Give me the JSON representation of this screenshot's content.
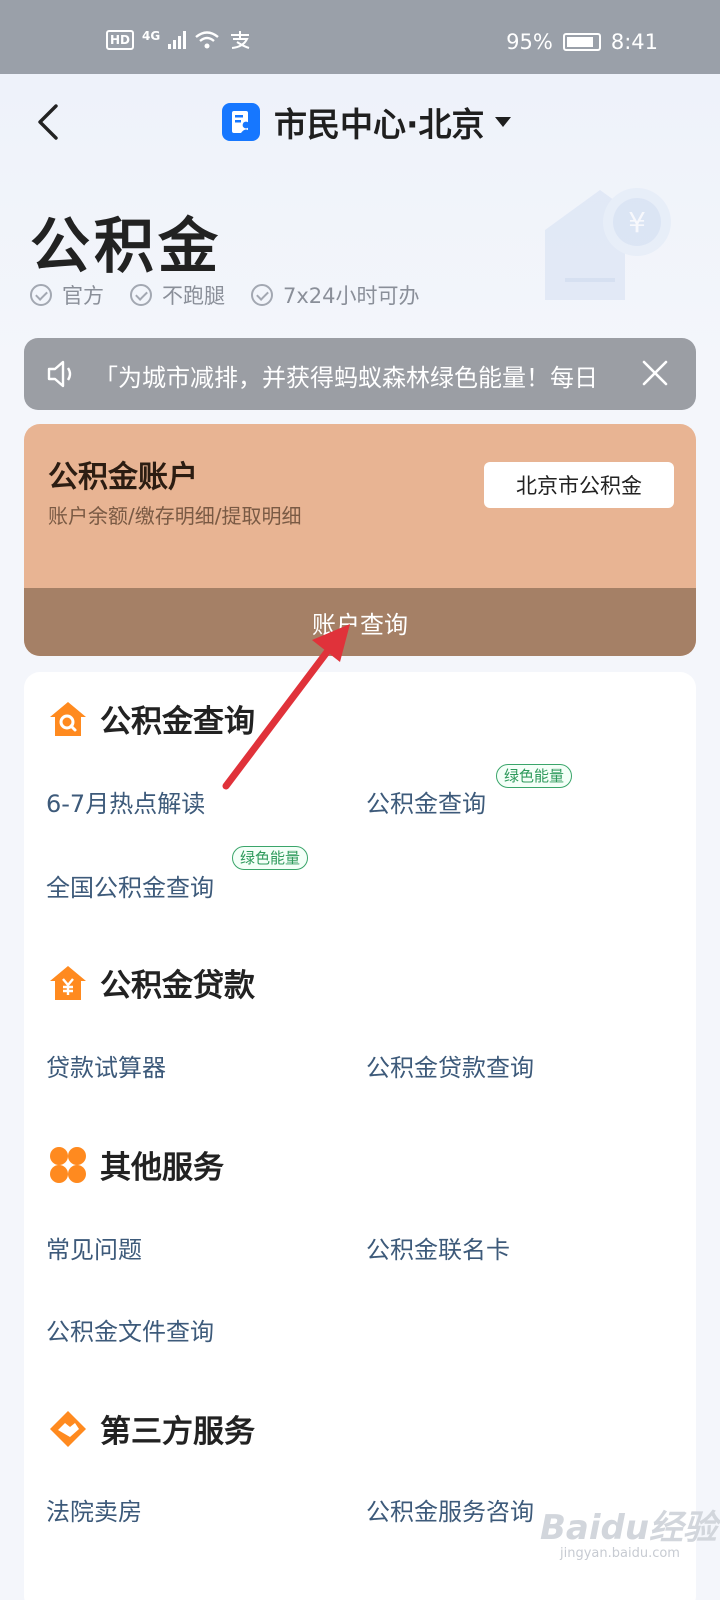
{
  "status_bar": {
    "hd": "HD",
    "network": "4G",
    "battery": "95%",
    "time": "8:41"
  },
  "nav": {
    "title": "市民中心·北京"
  },
  "header": {
    "title": "公积金",
    "tags": [
      "官方",
      "不跑腿",
      "7x24小时可办"
    ]
  },
  "notice": {
    "text": "「为城市减排，并获得蚂蚁森林绿色能量！每日"
  },
  "account": {
    "title": "公积金账户",
    "subtitle": "账户余额/缴存明细/提取明细",
    "city_button": "北京市公积金",
    "query_button": "账户查询"
  },
  "sections": [
    {
      "title": "公积金查询",
      "icon": "house-search-icon",
      "items": [
        {
          "label": "6-7月热点解读",
          "badge": ""
        },
        {
          "label": "公积金查询",
          "badge": "绿色能量"
        },
        {
          "label": "全国公积金查询",
          "badge": "绿色能量"
        }
      ]
    },
    {
      "title": "公积金贷款",
      "icon": "house-yen-icon",
      "items": [
        {
          "label": "贷款试算器",
          "badge": ""
        },
        {
          "label": "公积金贷款查询",
          "badge": ""
        }
      ]
    },
    {
      "title": "其他服务",
      "icon": "four-dots-icon",
      "items": [
        {
          "label": "常见问题",
          "badge": ""
        },
        {
          "label": "公积金联名卡",
          "badge": ""
        },
        {
          "label": "公积金文件查询",
          "badge": ""
        }
      ]
    },
    {
      "title": "第三方服务",
      "icon": "handshake-icon",
      "items": [
        {
          "label": "法院卖房",
          "badge": ""
        },
        {
          "label": "公积金服务咨询",
          "badge": ""
        }
      ]
    }
  ],
  "watermark": {
    "brand": "Baidu经验",
    "url": "jingyan.baidu.com"
  },
  "colors": {
    "accent": "#1677ff",
    "card": "#e8b493",
    "card_footer": "#a58066",
    "section_icon": "#ff8a1f",
    "badge": "#2e9a5c",
    "arrow": "#e0323a"
  }
}
